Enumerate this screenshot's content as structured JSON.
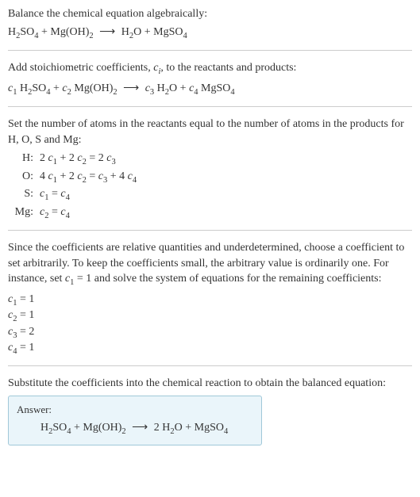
{
  "section1": {
    "title": "Balance the chemical equation algebraically:",
    "equation_html": "H<sub>2</sub>SO<sub>4</sub> + Mg(OH)<sub>2</sub> <span class='arrow'>⟶</span> H<sub>2</sub>O + MgSO<sub>4</sub>"
  },
  "section2": {
    "title_html": "Add stoichiometric coefficients, <span class='c-var'>c</span><span class='sub-i'>i</span>, to the reactants and products:",
    "equation_html": "<span class='c-var'>c</span><sub>1</sub> H<sub>2</sub>SO<sub>4</sub> + <span class='c-var'>c</span><sub>2</sub> Mg(OH)<sub>2</sub> <span class='arrow'>⟶</span> <span class='c-var'>c</span><sub>3</sub> H<sub>2</sub>O + <span class='c-var'>c</span><sub>4</sub> MgSO<sub>4</sub>"
  },
  "section3": {
    "title": "Set the number of atoms in the reactants equal to the number of atoms in the products for H, O, S and Mg:",
    "rows": [
      {
        "label": "H:",
        "eq_html": "2 <span class='c-var'>c</span><sub>1</sub> + 2 <span class='c-var'>c</span><sub>2</sub> = 2 <span class='c-var'>c</span><sub>3</sub>"
      },
      {
        "label": "O:",
        "eq_html": "4 <span class='c-var'>c</span><sub>1</sub> + 2 <span class='c-var'>c</span><sub>2</sub> = <span class='c-var'>c</span><sub>3</sub> + 4 <span class='c-var'>c</span><sub>4</sub>"
      },
      {
        "label": "S:",
        "eq_html": "<span class='c-var'>c</span><sub>1</sub> = <span class='c-var'>c</span><sub>4</sub>"
      },
      {
        "label": "Mg:",
        "eq_html": "<span class='c-var'>c</span><sub>2</sub> = <span class='c-var'>c</span><sub>4</sub>"
      }
    ]
  },
  "section4": {
    "title_html": "Since the coefficients are relative quantities and underdetermined, choose a coefficient to set arbitrarily. To keep the coefficients small, the arbitrary value is ordinarily one. For instance, set <span class='c-var'>c</span><sub>1</sub> = 1 and solve the system of equations for the remaining coefficients:",
    "lines": [
      "<span class='c-var'>c</span><sub>1</sub> = 1",
      "<span class='c-var'>c</span><sub>2</sub> = 1",
      "<span class='c-var'>c</span><sub>3</sub> = 2",
      "<span class='c-var'>c</span><sub>4</sub> = 1"
    ]
  },
  "section5": {
    "title": "Substitute the coefficients into the chemical reaction to obtain the balanced equation:",
    "answer_label": "Answer:",
    "answer_html": "H<sub>2</sub>SO<sub>4</sub> + Mg(OH)<sub>2</sub> <span class='arrow'>⟶</span> 2 H<sub>2</sub>O + MgSO<sub>4</sub>"
  },
  "chart_data": {
    "type": "table",
    "title": "Balancing chemical equation algebraically",
    "reaction": {
      "reactants": [
        "H2SO4",
        "Mg(OH)2"
      ],
      "products": [
        "H2O",
        "MgSO4"
      ]
    },
    "element_balance": [
      {
        "element": "H",
        "equation": "2c1 + 2c2 = 2c3"
      },
      {
        "element": "O",
        "equation": "4c1 + 2c2 = c3 + 4c4"
      },
      {
        "element": "S",
        "equation": "c1 = c4"
      },
      {
        "element": "Mg",
        "equation": "c2 = c4"
      }
    ],
    "solution": {
      "c1": 1,
      "c2": 1,
      "c3": 2,
      "c4": 1
    },
    "balanced_equation": "H2SO4 + Mg(OH)2 ⟶ 2 H2O + MgSO4"
  }
}
